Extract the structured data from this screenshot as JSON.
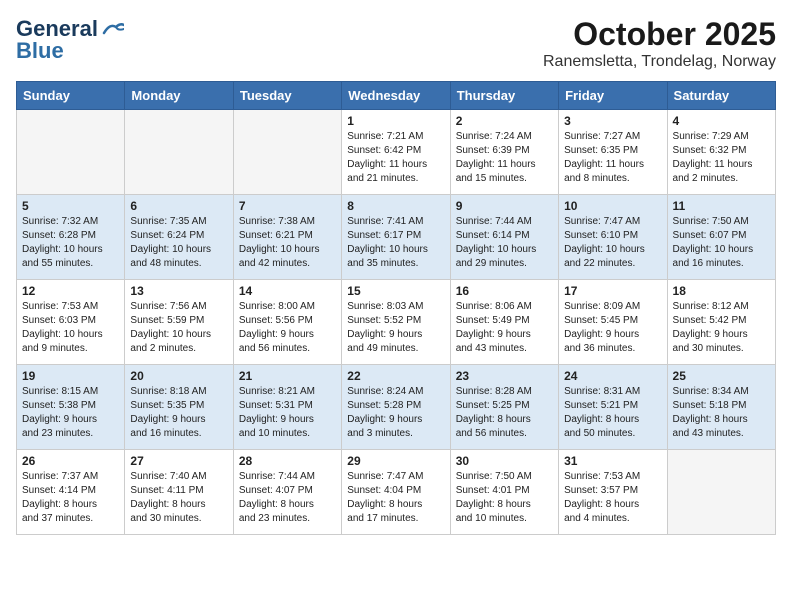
{
  "header": {
    "logo": {
      "line1": "General",
      "line2": "Blue"
    },
    "title": "October 2025",
    "subtitle": "Ranemsletta, Trondelag, Norway"
  },
  "calendar": {
    "days_of_week": [
      "Sunday",
      "Monday",
      "Tuesday",
      "Wednesday",
      "Thursday",
      "Friday",
      "Saturday"
    ],
    "weeks": [
      [
        {
          "day": "",
          "info": ""
        },
        {
          "day": "",
          "info": ""
        },
        {
          "day": "",
          "info": ""
        },
        {
          "day": "1",
          "info": "Sunrise: 7:21 AM\nSunset: 6:42 PM\nDaylight: 11 hours\nand 21 minutes."
        },
        {
          "day": "2",
          "info": "Sunrise: 7:24 AM\nSunset: 6:39 PM\nDaylight: 11 hours\nand 15 minutes."
        },
        {
          "day": "3",
          "info": "Sunrise: 7:27 AM\nSunset: 6:35 PM\nDaylight: 11 hours\nand 8 minutes."
        },
        {
          "day": "4",
          "info": "Sunrise: 7:29 AM\nSunset: 6:32 PM\nDaylight: 11 hours\nand 2 minutes."
        }
      ],
      [
        {
          "day": "5",
          "info": "Sunrise: 7:32 AM\nSunset: 6:28 PM\nDaylight: 10 hours\nand 55 minutes."
        },
        {
          "day": "6",
          "info": "Sunrise: 7:35 AM\nSunset: 6:24 PM\nDaylight: 10 hours\nand 48 minutes."
        },
        {
          "day": "7",
          "info": "Sunrise: 7:38 AM\nSunset: 6:21 PM\nDaylight: 10 hours\nand 42 minutes."
        },
        {
          "day": "8",
          "info": "Sunrise: 7:41 AM\nSunset: 6:17 PM\nDaylight: 10 hours\nand 35 minutes."
        },
        {
          "day": "9",
          "info": "Sunrise: 7:44 AM\nSunset: 6:14 PM\nDaylight: 10 hours\nand 29 minutes."
        },
        {
          "day": "10",
          "info": "Sunrise: 7:47 AM\nSunset: 6:10 PM\nDaylight: 10 hours\nand 22 minutes."
        },
        {
          "day": "11",
          "info": "Sunrise: 7:50 AM\nSunset: 6:07 PM\nDaylight: 10 hours\nand 16 minutes."
        }
      ],
      [
        {
          "day": "12",
          "info": "Sunrise: 7:53 AM\nSunset: 6:03 PM\nDaylight: 10 hours\nand 9 minutes."
        },
        {
          "day": "13",
          "info": "Sunrise: 7:56 AM\nSunset: 5:59 PM\nDaylight: 10 hours\nand 2 minutes."
        },
        {
          "day": "14",
          "info": "Sunrise: 8:00 AM\nSunset: 5:56 PM\nDaylight: 9 hours\nand 56 minutes."
        },
        {
          "day": "15",
          "info": "Sunrise: 8:03 AM\nSunset: 5:52 PM\nDaylight: 9 hours\nand 49 minutes."
        },
        {
          "day": "16",
          "info": "Sunrise: 8:06 AM\nSunset: 5:49 PM\nDaylight: 9 hours\nand 43 minutes."
        },
        {
          "day": "17",
          "info": "Sunrise: 8:09 AM\nSunset: 5:45 PM\nDaylight: 9 hours\nand 36 minutes."
        },
        {
          "day": "18",
          "info": "Sunrise: 8:12 AM\nSunset: 5:42 PM\nDaylight: 9 hours\nand 30 minutes."
        }
      ],
      [
        {
          "day": "19",
          "info": "Sunrise: 8:15 AM\nSunset: 5:38 PM\nDaylight: 9 hours\nand 23 minutes."
        },
        {
          "day": "20",
          "info": "Sunrise: 8:18 AM\nSunset: 5:35 PM\nDaylight: 9 hours\nand 16 minutes."
        },
        {
          "day": "21",
          "info": "Sunrise: 8:21 AM\nSunset: 5:31 PM\nDaylight: 9 hours\nand 10 minutes."
        },
        {
          "day": "22",
          "info": "Sunrise: 8:24 AM\nSunset: 5:28 PM\nDaylight: 9 hours\nand 3 minutes."
        },
        {
          "day": "23",
          "info": "Sunrise: 8:28 AM\nSunset: 5:25 PM\nDaylight: 8 hours\nand 56 minutes."
        },
        {
          "day": "24",
          "info": "Sunrise: 8:31 AM\nSunset: 5:21 PM\nDaylight: 8 hours\nand 50 minutes."
        },
        {
          "day": "25",
          "info": "Sunrise: 8:34 AM\nSunset: 5:18 PM\nDaylight: 8 hours\nand 43 minutes."
        }
      ],
      [
        {
          "day": "26",
          "info": "Sunrise: 7:37 AM\nSunset: 4:14 PM\nDaylight: 8 hours\nand 37 minutes."
        },
        {
          "day": "27",
          "info": "Sunrise: 7:40 AM\nSunset: 4:11 PM\nDaylight: 8 hours\nand 30 minutes."
        },
        {
          "day": "28",
          "info": "Sunrise: 7:44 AM\nSunset: 4:07 PM\nDaylight: 8 hours\nand 23 minutes."
        },
        {
          "day": "29",
          "info": "Sunrise: 7:47 AM\nSunset: 4:04 PM\nDaylight: 8 hours\nand 17 minutes."
        },
        {
          "day": "30",
          "info": "Sunrise: 7:50 AM\nSunset: 4:01 PM\nDaylight: 8 hours\nand 10 minutes."
        },
        {
          "day": "31",
          "info": "Sunrise: 7:53 AM\nSunset: 3:57 PM\nDaylight: 8 hours\nand 4 minutes."
        },
        {
          "day": "",
          "info": ""
        }
      ]
    ]
  }
}
